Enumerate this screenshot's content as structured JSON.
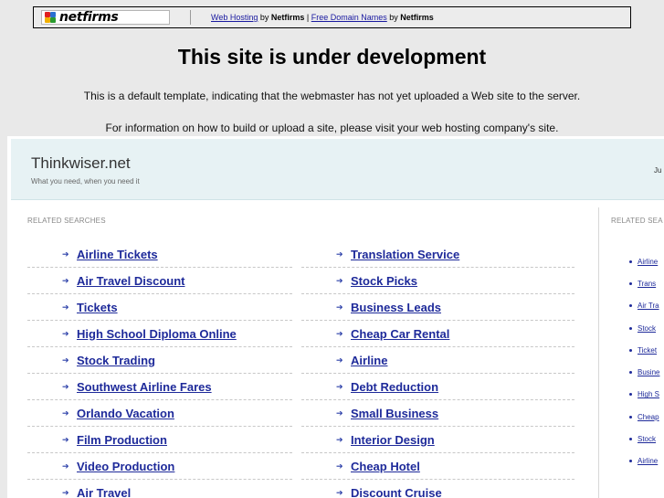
{
  "banner": {
    "logo_text": "netfirms",
    "link1": "Web Hosting",
    "by1": " by ",
    "brand1": "Netfirms",
    "pipe": " | ",
    "link2": "Free Domain Names",
    "by2": " by ",
    "brand2": "Netfirms"
  },
  "notice": {
    "title": "This site is under development",
    "line1": "This is a default template, indicating that the webmaster has not yet uploaded a Web site to the server.",
    "line2": "For information on how to build or upload a site, please visit your web hosting company's site."
  },
  "site": {
    "title": "Thinkwiser.net",
    "tagline": "What you need, when you need it",
    "date_fragment": "Ju",
    "related_label_left": "RELATED SEARCHES",
    "related_label_right": "RELATED SEA"
  },
  "links_col1": [
    "Airline Tickets",
    "Air Travel Discount",
    "Tickets",
    "High School Diploma Online",
    "Stock Trading",
    "Southwest Airline Fares",
    "Orlando Vacation",
    "Film Production",
    "Video Production",
    "Air Travel"
  ],
  "links_col2": [
    "Translation Service",
    "Stock Picks",
    "Business Leads",
    "Cheap Car Rental",
    "Airline",
    "Debt Reduction",
    "Small Business",
    "Interior Design",
    "Cheap Hotel",
    "Discount Cruise"
  ],
  "side_links": [
    "Airline",
    "Trans",
    "Air Tra",
    "Stock",
    "Ticket",
    "Busine",
    "High S",
    "Cheap",
    "Stock",
    "Airline"
  ],
  "colors": {
    "link": "#1e2a9a",
    "header_bg": "#e7f2f4",
    "page_bg": "#e9e9e9"
  },
  "icons": {
    "bullet": "arrow-right-icon",
    "logo": "netfirms-logo-icon"
  }
}
